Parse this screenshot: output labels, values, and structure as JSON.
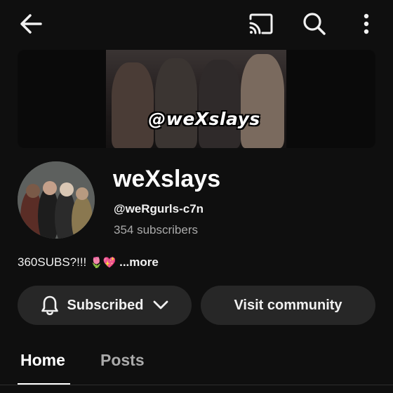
{
  "header": {
    "back_icon": "arrow-left-icon",
    "cast_icon": "cast-icon",
    "search_icon": "search-icon",
    "more_icon": "more-vertical-icon"
  },
  "banner": {
    "handle_text": "@weXslays"
  },
  "channel": {
    "name": "weXslays",
    "handle": "@weRgurls-c7n",
    "subscribers": "354 subscribers"
  },
  "description": {
    "text": "360SUBS?!!!",
    "emojis": "🌷💖",
    "more_label": "...more"
  },
  "actions": {
    "subscribed_label": "Subscribed",
    "community_label": "Visit community"
  },
  "tabs": [
    {
      "label": "Home",
      "active": true
    },
    {
      "label": "Posts",
      "active": false
    }
  ],
  "colors": {
    "background": "#0f0f0f",
    "button_bg": "#272727",
    "secondary_text": "#aaaaaa"
  }
}
